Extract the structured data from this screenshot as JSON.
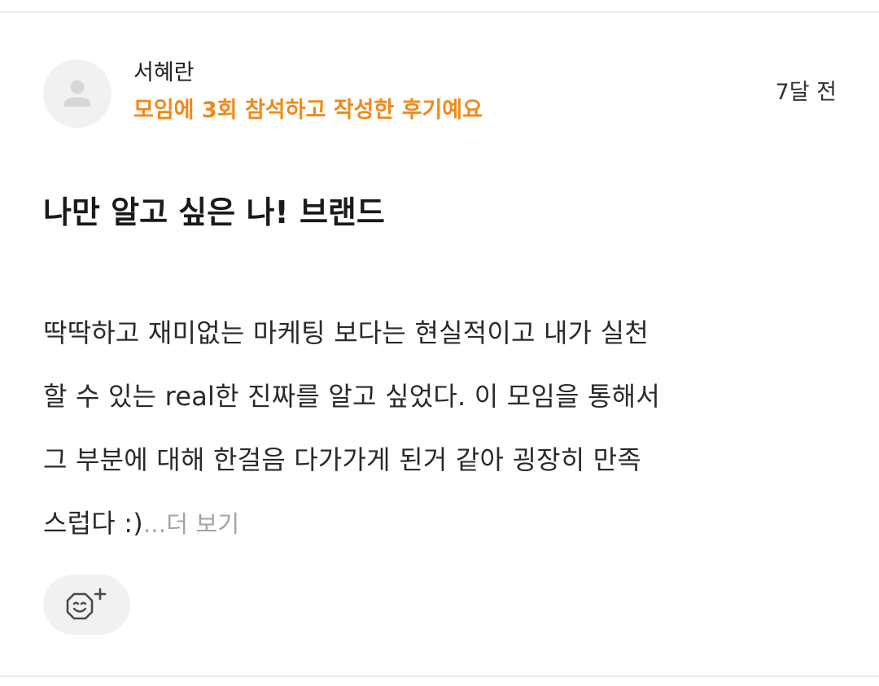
{
  "review": {
    "author": "서혜란",
    "attendance_note": "모임에 3회 참석하고 작성한 후기예요",
    "time_ago": "7달 전",
    "title": "나만 알고 싶은 나! 브랜드",
    "body_lines": [
      "딱딱하고 재미없는 마케팅 보다는 현실적이고 내가 실천",
      "할 수 있는 real한 진짜를 알고 싶었다. 이 모임을 통해서",
      "그 부분에 대해 한걸음 다가가게 된거 같아 굉장히 만족",
      "스럽다 :)"
    ],
    "more_label": "...더 보기",
    "reaction_icon": "add-reaction-icon",
    "avatar_icon": "default-user-icon"
  },
  "colors": {
    "accent": "#ef8a1a",
    "muted": "#a3a3a3",
    "surface": "#f1f1f1",
    "divider": "#e9e9e9"
  }
}
